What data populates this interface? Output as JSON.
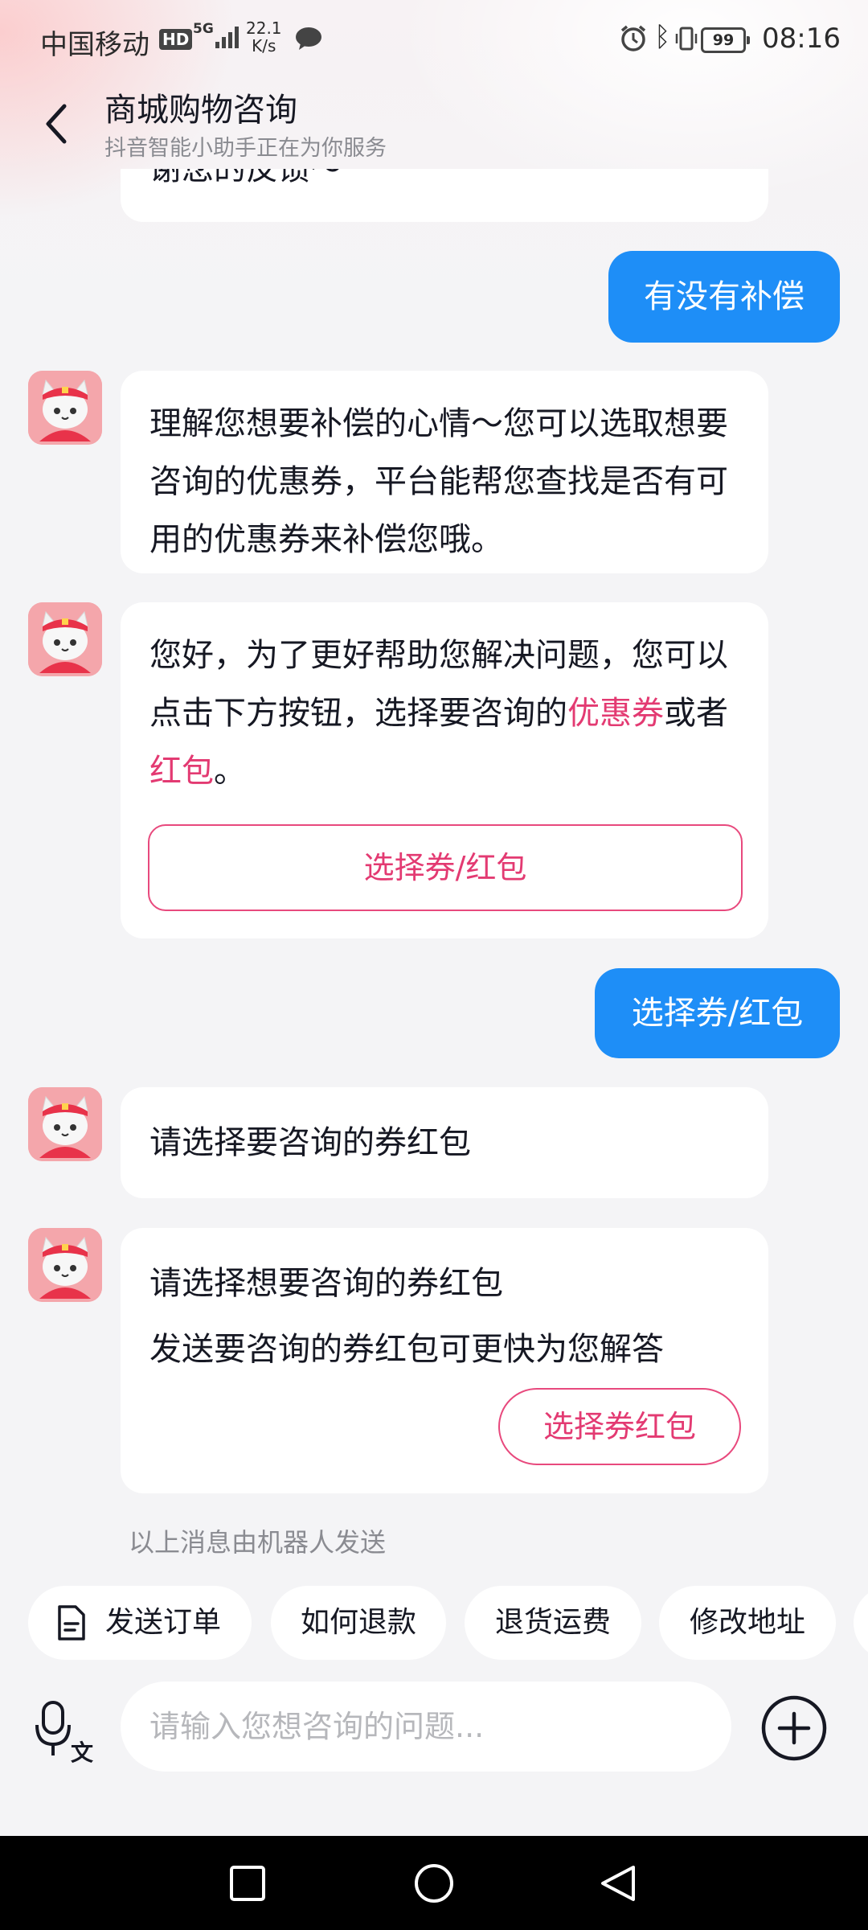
{
  "status_bar": {
    "carrier": "中国移动",
    "hd": "HD",
    "network": "5G",
    "speed_value": "22.1",
    "speed_unit": "K/s",
    "battery": "99",
    "time": "08:16"
  },
  "header": {
    "title": "商城购物咨询",
    "subtitle": "抖音智能小助手正在为你服务"
  },
  "messages": {
    "m0": "谢您的反馈～",
    "m1": "有没有补偿",
    "m2": "理解您想要补偿的心情～您可以选取想要咨询的优惠券，平台能帮您查找是否有可用的优惠券来补偿您哦。",
    "m3": {
      "part1": "您好，为了更好帮助您解决问题，您可以点击下方按钮，选择要咨询的",
      "link1": "优惠券",
      "part2": "或者",
      "link2": "红包",
      "part3": "。",
      "button": "选择券/红包"
    },
    "m4": "选择券/红包",
    "m5": "请选择要咨询的券红包",
    "m6": {
      "line1": "请选择想要咨询的券红包",
      "line2": "发送要咨询的券红包可更快为您解答",
      "button": "选择券红包"
    }
  },
  "notice": "以上消息由机器人发送",
  "quick_chips": [
    "发送订单",
    "如何退款",
    "退货运费",
    "修改地址"
  ],
  "input": {
    "placeholder": "请输入您想咨询的问题..."
  },
  "colors": {
    "user_bubble": "#1e8ef7",
    "accent_pink": "#e33a72",
    "background": "#f4f4f6"
  }
}
